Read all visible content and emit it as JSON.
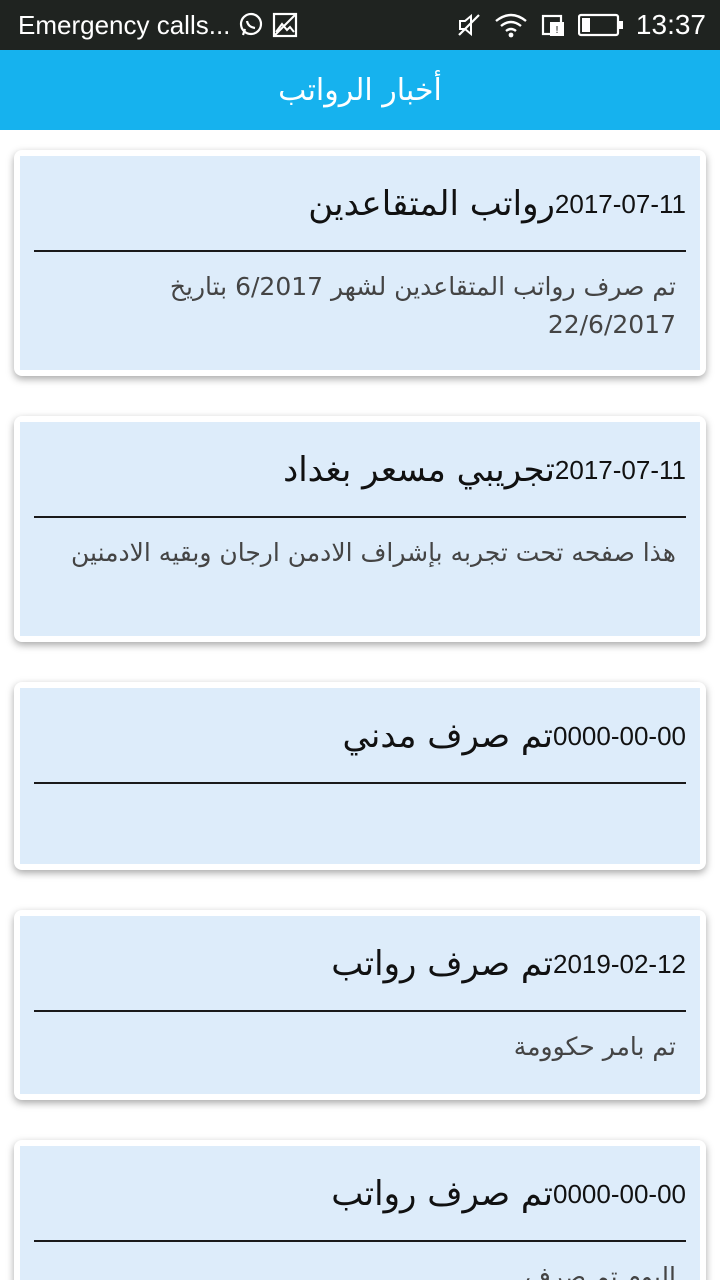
{
  "status_bar": {
    "notification_text": "Emergency calls...",
    "time": "13:37",
    "icons": [
      "whatsapp-icon",
      "image-icon",
      "mute-icon",
      "wifi-icon",
      "sim-icon",
      "battery-icon"
    ]
  },
  "app_bar": {
    "title": "أخبار الرواتب",
    "color": "#16b2ee"
  },
  "colors": {
    "card_background": "#ddecfa",
    "text_primary": "#111111",
    "text_secondary": "#444444"
  },
  "news": [
    {
      "title": "رواتب المتقاعدين",
      "date": "2017-07-11",
      "body": "تم صرف رواتب المتقاعدين لشهر 6/2017 بتاريخ 22/6/2017"
    },
    {
      "title": "تجريبي مسعر بغداد",
      "date": "2017-07-11",
      "body": "هذا صفحه تحت تجربه بإشراف الادمن ارجان وبقيه الادمنين"
    },
    {
      "title": "تم صرف مدني",
      "date": "0000-00-00",
      "body": ""
    },
    {
      "title": "تم صرف رواتب",
      "date": "2019-02-12",
      "body": "تم بامر حكوومة"
    },
    {
      "title": "تم صرف رواتب",
      "date": "0000-00-00",
      "body": "اليوم تم صرف"
    }
  ]
}
